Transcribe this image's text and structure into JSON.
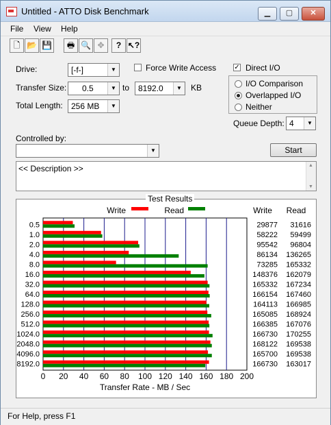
{
  "window": {
    "title": "Untitled - ATTO Disk Benchmark"
  },
  "menu": [
    "File",
    "View",
    "Help"
  ],
  "toolbar": [
    "new-icon",
    "open-icon",
    "save-icon",
    "print-icon",
    "print-preview-icon",
    "move-icon",
    "help-icon",
    "context-help-icon"
  ],
  "form": {
    "drive_label": "Drive:",
    "drive_value": "[-f-]",
    "force_write_label": "Force Write Access",
    "direct_io_label": "Direct I/O",
    "direct_io_checked": true,
    "transfer_size_label": "Transfer Size:",
    "transfer_from": "0.5",
    "to_label": "to",
    "transfer_to": "8192.0",
    "kb_label": "KB",
    "total_length_label": "Total Length:",
    "total_length_value": "256 MB",
    "io_comparison_label": "I/O Comparison",
    "overlapped_io_label": "Overlapped I/O",
    "neither_label": "Neither",
    "queue_depth_label": "Queue Depth:",
    "queue_depth_value": "4",
    "controlled_by_label": "Controlled by:",
    "controlled_by_value": "",
    "start_label": "Start",
    "description": "<< Description >>"
  },
  "results": {
    "title": "Test Results",
    "legend_write": "Write",
    "legend_read": "Read",
    "col_write": "Write",
    "col_read": "Read",
    "write_color": "#ff0000",
    "read_color": "#008000",
    "rows": [
      {
        "size": "0.5",
        "write": "29877",
        "read": "31616"
      },
      {
        "size": "1.0",
        "write": "58222",
        "read": "59499"
      },
      {
        "size": "2.0",
        "write": "95542",
        "read": "96804"
      },
      {
        "size": "4.0",
        "write": "86134",
        "read": "136265"
      },
      {
        "size": "8.0",
        "write": "73285",
        "read": "165332"
      },
      {
        "size": "16.0",
        "write": "148376",
        "read": "162079"
      },
      {
        "size": "32.0",
        "write": "165332",
        "read": "167234"
      },
      {
        "size": "64.0",
        "write": "166154",
        "read": "167460"
      },
      {
        "size": "128.0",
        "write": "164113",
        "read": "166985"
      },
      {
        "size": "256.0",
        "write": "165085",
        "read": "168924"
      },
      {
        "size": "512.0",
        "write": "166385",
        "read": "167076"
      },
      {
        "size": "1024.0",
        "write": "166730",
        "read": "170255"
      },
      {
        "size": "2048.0",
        "write": "168122",
        "read": "169538"
      },
      {
        "size": "4096.0",
        "write": "165700",
        "read": "169538"
      },
      {
        "size": "8192.0",
        "write": "166730",
        "read": "163017"
      }
    ],
    "x_ticks": [
      "0",
      "20",
      "40",
      "60",
      "80",
      "100",
      "120",
      "140",
      "160",
      "180",
      "200"
    ],
    "xlabel": "Transfer Rate - MB / Sec"
  },
  "chart_data": {
    "type": "bar",
    "title": "Test Results",
    "categories": [
      "0.5",
      "1.0",
      "2.0",
      "4.0",
      "8.0",
      "16.0",
      "32.0",
      "64.0",
      "128.0",
      "256.0",
      "512.0",
      "1024.0",
      "2048.0",
      "4096.0",
      "8192.0"
    ],
    "series": [
      {
        "name": "Write",
        "values": [
          29.2,
          56.9,
          93.3,
          84.1,
          71.6,
          144.9,
          161.5,
          162.3,
          160.3,
          161.2,
          162.5,
          162.8,
          164.2,
          161.8,
          162.8
        ]
      },
      {
        "name": "Read",
        "values": [
          30.9,
          58.1,
          94.5,
          133.1,
          161.5,
          158.3,
          163.3,
          163.5,
          163.1,
          165.0,
          163.2,
          166.3,
          165.6,
          165.6,
          159.2
        ]
      }
    ],
    "xlabel": "Transfer Rate - MB / Sec",
    "xlim": [
      0,
      200
    ]
  },
  "status": {
    "text": "For Help, press F1"
  }
}
